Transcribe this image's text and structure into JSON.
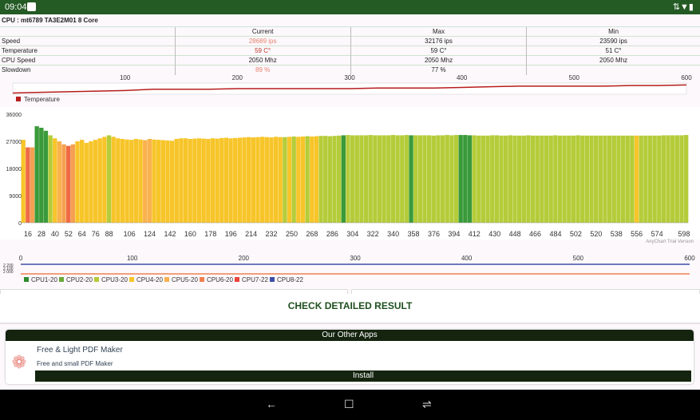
{
  "status_bar": {
    "time": "09:04",
    "icons": [
      "notification-icon",
      "signal-icon",
      "wifi-icon",
      "battery-icon"
    ]
  },
  "cpu_title": "CPU : mt6789 TA3E2M01 8 Core",
  "stats": {
    "columns": [
      "",
      "Current",
      "Max",
      "Min"
    ],
    "rows": [
      {
        "label": "Speed",
        "current": "28689 ips",
        "max": "32176 ips",
        "min": "23590 ips"
      },
      {
        "label": "Temperature",
        "current": "59 C°",
        "max": "59 C°",
        "min": "51 C°"
      },
      {
        "label": "CPU Speed",
        "current": "2050 Mhz",
        "max": "2050 Mhz",
        "min": "2050 Mhz"
      },
      {
        "label": "Slowdown",
        "current": "89 %",
        "max": "77 %",
        "min": ""
      }
    ],
    "highlight_color": "#e8826e"
  },
  "chart_data": [
    {
      "type": "line",
      "x_ticks": [
        "100",
        "200",
        "300",
        "400",
        "500",
        "600"
      ],
      "xlim": [
        0,
        600
      ],
      "ylim": [
        51,
        60
      ],
      "series": [
        {
          "name": "Temperature",
          "color": "#b71c1c",
          "x": [
            0,
            25,
            50,
            75,
            100,
            125,
            150,
            175,
            200,
            225,
            250,
            275,
            300,
            325,
            350,
            375,
            400,
            425,
            450,
            475,
            500,
            525,
            550,
            575,
            600
          ],
          "values": [
            52,
            52.5,
            53,
            53.5,
            54,
            55,
            55,
            55,
            55.5,
            55.5,
            55.5,
            55.5,
            55.5,
            56,
            56,
            56,
            56.5,
            57,
            57.5,
            57.5,
            57.5,
            57.5,
            58,
            58,
            58.5
          ]
        }
      ],
      "legend": "bottom-left"
    },
    {
      "type": "bar",
      "ylim": [
        0,
        36000
      ],
      "y_ticks": [
        "36000",
        "27000",
        "18000",
        "9000",
        "0"
      ],
      "x_ticks": [
        "16",
        "28",
        "40",
        "52",
        "64",
        "76",
        "88",
        "106",
        "124",
        "142",
        "160",
        "178",
        "196",
        "214",
        "232",
        "250",
        "268",
        "286",
        "304",
        "322",
        "340",
        "358",
        "376",
        "394",
        "412",
        "430",
        "448",
        "466",
        "484",
        "502",
        "520",
        "538",
        "556",
        "574",
        "598"
      ],
      "x_start": 12,
      "x_step": 4,
      "values": [
        27500,
        25000,
        25000,
        32000,
        31500,
        30500,
        29000,
        28000,
        27000,
        26000,
        25500,
        26000,
        27000,
        27500,
        26500,
        27000,
        27500,
        28000,
        28500,
        29000,
        28500,
        28000,
        27800,
        27600,
        27500,
        27800,
        27600,
        27400,
        27800,
        27600,
        27500,
        27400,
        27300,
        27200,
        27800,
        28000,
        28000,
        27800,
        27900,
        28000,
        27900,
        27800,
        28000,
        27900,
        28100,
        28200,
        28000,
        28100,
        28200,
        28300,
        28400,
        28300,
        28400,
        28500,
        28400,
        28300,
        28500,
        28400,
        28400,
        28500,
        28600,
        28500,
        28600,
        28700,
        28600,
        28700,
        28800,
        28800,
        28700,
        28800,
        28900,
        29000,
        29100,
        29000,
        29000,
        29000,
        29000,
        29100,
        29000,
        29000,
        29000,
        29000,
        29100,
        29000,
        29000,
        29100,
        29000,
        29000,
        29000,
        29000,
        29000,
        28900,
        29000,
        29000,
        29100,
        29000,
        29100,
        29100,
        29100,
        29000,
        29000,
        28900,
        28900,
        28900,
        29000,
        29000,
        28900,
        28900,
        29000,
        28900,
        28900,
        28900,
        29000,
        28900,
        28900,
        28900,
        28900,
        28900,
        29000,
        28900,
        28900,
        28900,
        28900,
        29000,
        28900,
        28900,
        28900,
        28900,
        28900,
        28900,
        28900,
        28900,
        28900,
        28900,
        28900,
        28900,
        28900,
        28900,
        28900,
        28900,
        28900,
        28900,
        29000,
        29000,
        29000,
        29000,
        29000,
        29100
      ],
      "core_index": [
        2,
        5,
        4,
        0,
        0,
        0,
        1,
        2,
        3,
        4,
        5,
        4,
        2,
        2,
        2,
        2,
        2,
        2,
        2,
        1,
        2,
        2,
        2,
        2,
        2,
        2,
        2,
        3,
        3,
        2,
        2,
        2,
        2,
        2,
        2,
        2,
        2,
        2,
        2,
        2,
        2,
        2,
        2,
        2,
        2,
        2,
        2,
        2,
        2,
        2,
        2,
        2,
        2,
        2,
        2,
        2,
        2,
        2,
        1,
        2,
        1,
        2,
        2,
        1,
        2,
        2,
        1,
        1,
        1,
        1,
        1,
        0,
        1,
        1,
        1,
        1,
        1,
        1,
        1,
        1,
        1,
        1,
        1,
        1,
        1,
        1,
        0,
        1,
        1,
        1,
        1,
        1,
        1,
        1,
        1,
        1,
        1,
        0,
        0,
        0,
        1,
        1,
        1,
        1,
        1,
        1,
        1,
        1,
        1,
        1,
        1,
        1,
        1,
        1,
        1,
        1,
        1,
        1,
        1,
        1,
        1,
        1,
        1,
        1,
        1,
        1,
        1,
        1,
        1,
        1,
        1,
        1,
        1,
        1,
        1,
        1,
        2,
        1,
        1,
        1,
        1,
        1,
        1,
        1,
        1,
        1,
        1,
        1
      ],
      "watermark": "AnyChart Trial Version"
    },
    {
      "type": "line",
      "x_ticks": [
        "0",
        "100",
        "200",
        "300",
        "400",
        "500",
        "600"
      ],
      "xlim": [
        0,
        600
      ],
      "y_ticks": [
        "2 200",
        "2 100",
        "2 000"
      ],
      "series": [
        {
          "name": "CPU8-22",
          "color": "#3f4fa8",
          "value": 2200
        },
        {
          "name": "CPU6-20",
          "color": "#f08050",
          "value": 2050
        }
      ],
      "legend": [
        {
          "name": "CPU1-20",
          "color": "#2e8b2e"
        },
        {
          "name": "CPU2-20",
          "color": "#6aa83a"
        },
        {
          "name": "CPU3-20",
          "color": "#b5c93a"
        },
        {
          "name": "CPU4-20",
          "color": "#f7c52a"
        },
        {
          "name": "CPU5-20",
          "color": "#f9b04e"
        },
        {
          "name": "CPU6-20",
          "color": "#f08050"
        },
        {
          "name": "CPU7-22",
          "color": "#e8443a"
        },
        {
          "name": "CPU8-22",
          "color": "#3f4fa8"
        }
      ]
    }
  ],
  "bar_colors": [
    "#3a9a3a",
    "#b5cc3a",
    "#f7c52a",
    "#f9b24e",
    "#f5a050",
    "#ef6a45",
    "#e8443a"
  ],
  "check_button": "CHECK DETAILED RESULT",
  "other_apps": {
    "header": "Our Other Apps",
    "app_title": "Free & Light PDF Maker",
    "app_subtitle": "Free and small PDF Maker",
    "install": "Install"
  },
  "nav": {
    "back": "←",
    "home": "☐",
    "recents": "⇌"
  }
}
